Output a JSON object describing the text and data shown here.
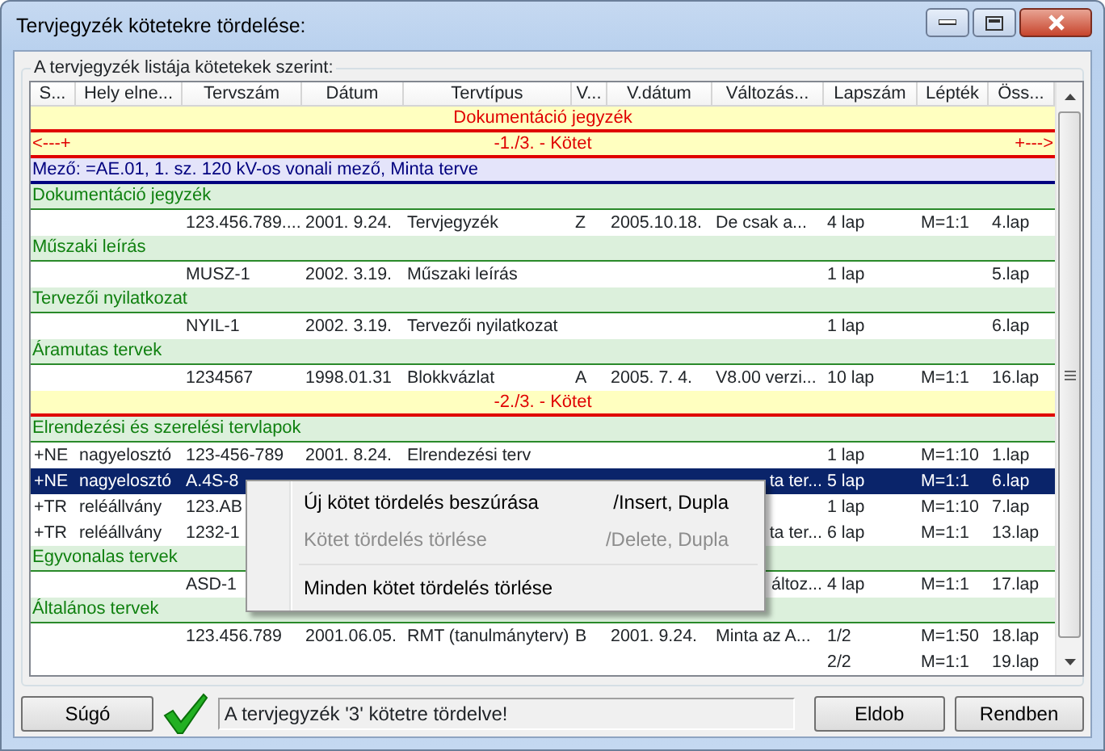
{
  "window": {
    "title": "Tervjegyzék kötetekre tördelése:"
  },
  "group_box": {
    "label": "A tervjegyzék listája kötetekek szerint:"
  },
  "table": {
    "columns": [
      "S...",
      "Hely elne...",
      "Tervszám",
      "Dátum",
      "Tervtípus",
      "V...",
      "V.dátum",
      "Változás...",
      "Lapszám",
      "Lépték",
      "Öss..."
    ],
    "rows": [
      {
        "kind": "document",
        "text": "Dokumentáció jegyzék"
      },
      {
        "kind": "volume",
        "text": "-1./3. - Kötet",
        "left": "<---+",
        "right": "+--->"
      },
      {
        "kind": "field",
        "text": "Mező: =AE.01, 1. sz. 120 kV-os vonali mező, Minta terve"
      },
      {
        "kind": "group",
        "text": "Dokumentáció jegyzék"
      },
      {
        "kind": "item",
        "selected": false,
        "cells": [
          "",
          "",
          "123.456.789....",
          "2001. 9.24.",
          "Tervjegyzék",
          "Z",
          "2005.10.18.",
          "De csak a...",
          "4 lap",
          "M=1:1",
          "4.lap"
        ]
      },
      {
        "kind": "group",
        "text": "Műszaki leírás"
      },
      {
        "kind": "item",
        "selected": false,
        "cells": [
          "",
          "",
          "MUSZ-1",
          "2002. 3.19.",
          "Műszaki leírás",
          "",
          "",
          "",
          "1 lap",
          "",
          "5.lap"
        ]
      },
      {
        "kind": "group",
        "text": "Tervezői nyilatkozat"
      },
      {
        "kind": "item",
        "selected": false,
        "cells": [
          "",
          "",
          "NYIL-1",
          "2002. 3.19.",
          "Tervezői nyilatkozat",
          "",
          "",
          "",
          "1 lap",
          "",
          "6.lap"
        ]
      },
      {
        "kind": "group",
        "text": "Áramutas tervek"
      },
      {
        "kind": "item",
        "selected": false,
        "cells": [
          "",
          "",
          "1234567",
          "1998.01.31",
          "Blokkvázlat",
          "A",
          "2005. 7. 4.",
          "V8.00 verzi...",
          "10 lap",
          "M=1:1",
          "16.lap"
        ]
      },
      {
        "kind": "volume",
        "text": "-2./3. - Kötet"
      },
      {
        "kind": "group",
        "text": "Elrendezési és szerelési tervlapok"
      },
      {
        "kind": "item",
        "selected": false,
        "cells": [
          "+NE",
          "nagyelosztó",
          "123-456-789",
          "2001. 8.24.",
          "Elrendezési terv",
          "",
          "",
          "",
          "1 lap",
          "M=1:10",
          "1.lap"
        ]
      },
      {
        "kind": "item",
        "selected": true,
        "cut_start": true,
        "cells": [
          "+NE",
          "nagyelosztó",
          "A.4S-8",
          "",
          "",
          "",
          "",
          "ta ter...",
          "5 lap",
          "M=1:1",
          "6.lap"
        ]
      },
      {
        "kind": "item",
        "selected": false,
        "cells": [
          "+TR",
          "reléállvány",
          "123.AB",
          "",
          "",
          "",
          "",
          "",
          "1 lap",
          "M=1:10",
          "7.lap"
        ]
      },
      {
        "kind": "item",
        "selected": false,
        "cut_start": true,
        "cells": [
          "+TR",
          "reléállvány",
          "1232-1",
          "",
          "",
          "",
          "",
          "ta ter...",
          "6 lap",
          "M=1:1",
          "13.lap"
        ]
      },
      {
        "kind": "group",
        "text": "Egyvonalas tervek"
      },
      {
        "kind": "item",
        "selected": false,
        "cut_start": true,
        "cells": [
          "",
          "",
          "ASD-1",
          "",
          "",
          "",
          "",
          "áltoz...",
          "4 lap",
          "M=1:1",
          "17.lap"
        ]
      },
      {
        "kind": "group",
        "text": "Általános tervek"
      },
      {
        "kind": "item",
        "selected": false,
        "cells": [
          "",
          "",
          "123.456.789",
          "2001.06.05.",
          "RMT (tanulmányterv)",
          "B",
          "2001. 9.24.",
          "Minta az A...",
          "1/2",
          "M=1:50",
          "18.lap"
        ]
      },
      {
        "kind": "item",
        "selected": false,
        "cells": [
          "",
          "",
          "",
          "",
          "",
          "",
          "",
          "",
          "2/2",
          "M=1:1",
          "19.lap"
        ]
      }
    ]
  },
  "context_menu": {
    "items": [
      {
        "kind": "item",
        "label": "Új kötet tördelés beszúrása",
        "shortcut": "/Insert, Dupla",
        "disabled": false
      },
      {
        "kind": "item",
        "label": "Kötet tördelés törlése",
        "shortcut": "/Delete, Dupla",
        "disabled": true
      },
      {
        "kind": "separator"
      },
      {
        "kind": "item",
        "label": "Minden kötet tördelés törlése",
        "disabled": false
      }
    ]
  },
  "footer": {
    "help_button": "Súgó",
    "status": "A tervjegyzék '3' kötetre tördelve!",
    "buttons": [
      "Eldob",
      "Rendben"
    ]
  }
}
